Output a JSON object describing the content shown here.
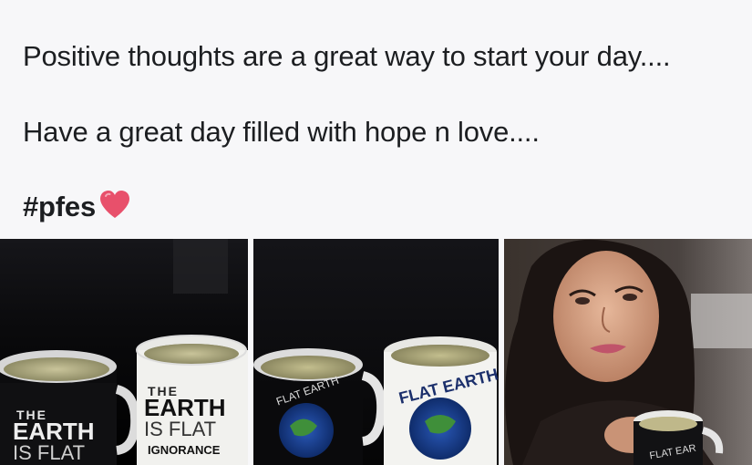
{
  "post": {
    "lines": [
      "Positive thoughts are a great way to start your day....",
      "Have a great day filled with hope n love....",
      "#pfes"
    ],
    "heart_emoji": "heart-emoji"
  },
  "photos": [
    {
      "name": "mugs-photo-1",
      "mug_left_text": [
        "THE",
        "EARTH",
        "IS",
        "FLAT"
      ],
      "mug_right_text": [
        "THE",
        "EARTH",
        "IS",
        "FLAT",
        "IGNORANCE"
      ]
    },
    {
      "name": "mugs-photo-2",
      "mug_text": "FLAT EARTH"
    },
    {
      "name": "woman-with-mug-photo",
      "mug_text": "FLAT EAR"
    }
  ],
  "colors": {
    "text": "#1c1e21",
    "background": "#f7f7f9",
    "heart": "#e8506b"
  }
}
